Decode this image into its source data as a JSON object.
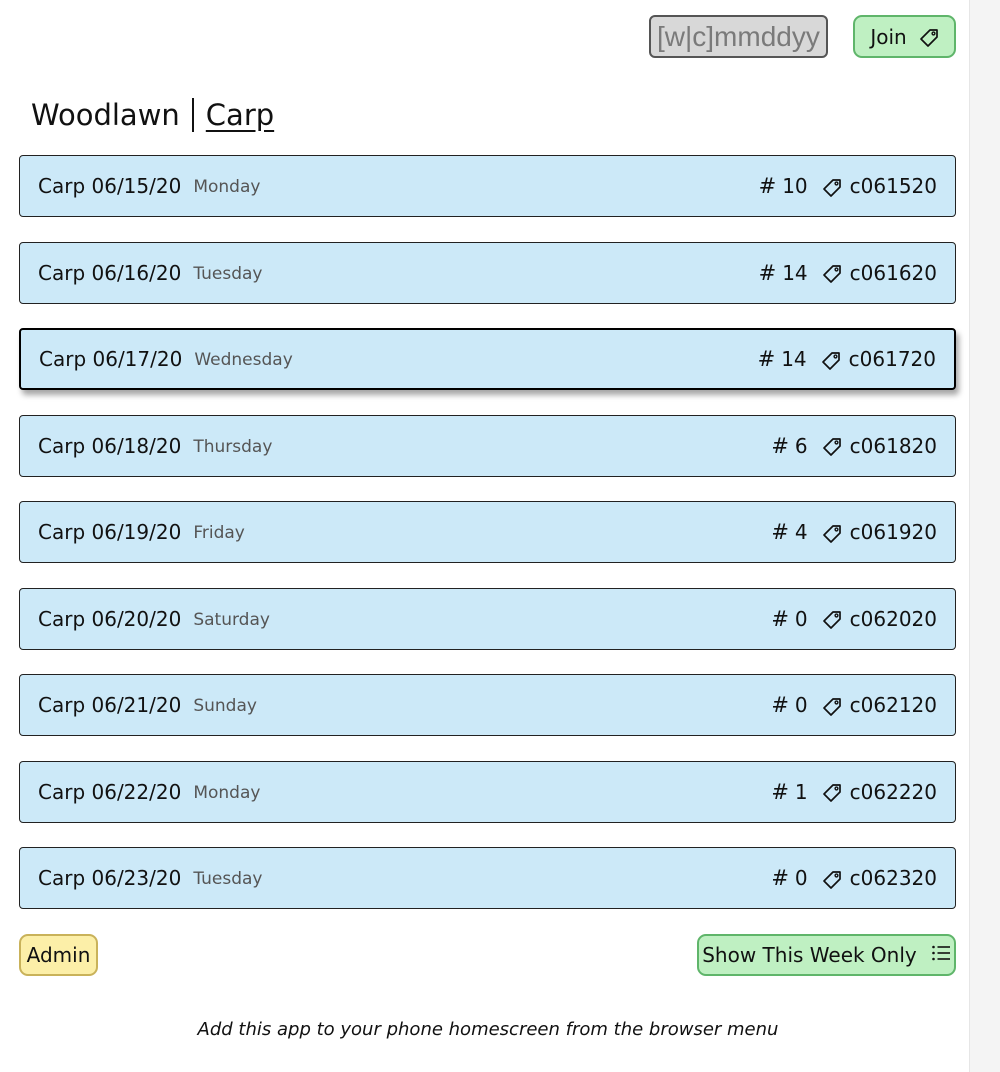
{
  "topbar": {
    "code_input_placeholder": "[w|c]mmddyy",
    "code_input_value": "",
    "join_label": "Join"
  },
  "header": {
    "location": "Woodlawn",
    "separator": "|",
    "group": "Carp"
  },
  "sessions": [
    {
      "title": "Carp 06/15/20",
      "day": "Monday",
      "count": "10",
      "code": "c061520"
    },
    {
      "title": "Carp 06/16/20",
      "day": "Tuesday",
      "count": "14",
      "code": "c061620"
    },
    {
      "title": "Carp 06/17/20",
      "day": "Wednesday",
      "count": "14",
      "code": "c061720"
    },
    {
      "title": "Carp 06/18/20",
      "day": "Thursday",
      "count": "6",
      "code": "c061820"
    },
    {
      "title": "Carp 06/19/20",
      "day": "Friday",
      "count": "4",
      "code": "c061920"
    },
    {
      "title": "Carp 06/20/20",
      "day": "Saturday",
      "count": "0",
      "code": "c062020"
    },
    {
      "title": "Carp 06/21/20",
      "day": "Sunday",
      "count": "0",
      "code": "c062120"
    },
    {
      "title": "Carp 06/22/20",
      "day": "Monday",
      "count": "1",
      "code": "c062220"
    },
    {
      "title": "Carp 06/23/20",
      "day": "Tuesday",
      "count": "0",
      "code": "c062320"
    }
  ],
  "selected_session": "Carp 06/17/20",
  "count_symbol": "#",
  "actions": {
    "admin_label": "Admin",
    "week_label": "Show This Week Only"
  },
  "footer": {
    "note": "Add this app to your phone homescreen from the browser menu"
  },
  "colors": {
    "row_background": "#cce9f8",
    "green_button": "#bff0c2",
    "yellow_button": "#fcefa8"
  },
  "icons": {
    "join": "tag-icon",
    "row_code": "tag-icon",
    "week": "list-icon"
  }
}
